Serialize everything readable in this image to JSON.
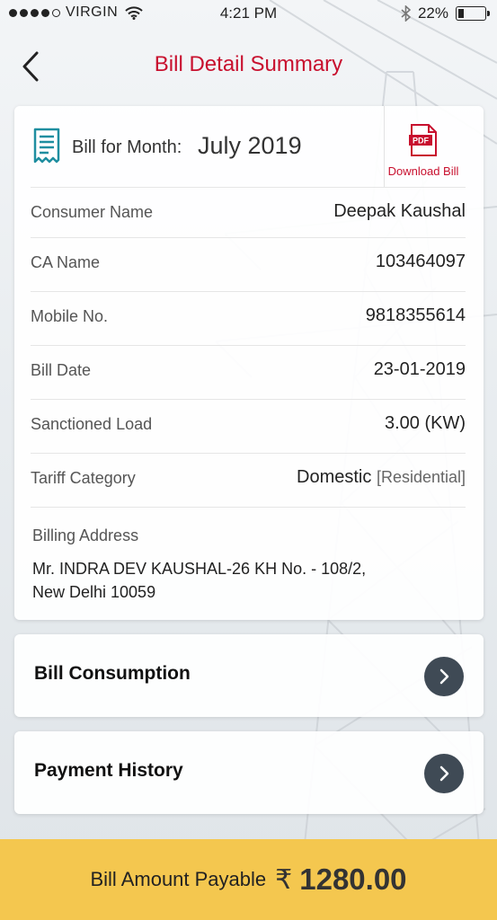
{
  "status_bar": {
    "carrier": "VIRGIN",
    "time": "4:21 PM",
    "battery": "22%",
    "battery_level": 0.22
  },
  "nav": {
    "title": "Bill Detail Summary"
  },
  "bill_header": {
    "label": "Bill for Month:",
    "month": "July 2019",
    "pdf_badge": "PDF",
    "download_label": "Download Bill"
  },
  "details": [
    {
      "label": "Consumer Name",
      "value": "Deepak Kaushal"
    },
    {
      "label": "CA Name",
      "value": "103464097"
    },
    {
      "label": "Mobile No.",
      "value": "9818355614"
    },
    {
      "label": "Bill Date",
      "value": "23-01-2019"
    },
    {
      "label": "Sanctioned Load",
      "value": "3.00 (KW)"
    },
    {
      "label": "Tariff Category",
      "value": "Domestic",
      "value_sub": "[Residential]"
    }
  ],
  "address": {
    "label": "Billing Address",
    "line1": "Mr. INDRA DEV KAUSHAL-26 KH No. - 108/2,",
    "line2": "New Delhi 10059"
  },
  "links": [
    {
      "label": "Bill Consumption"
    },
    {
      "label": "Payment History"
    }
  ],
  "footer": {
    "label": "Bill Amount Payable",
    "currency_symbol": "₹",
    "amount": "1280.00"
  },
  "colors": {
    "accent_red": "#c8102e",
    "footer_yellow": "#f4c74f",
    "icon_teal": "#1f8ea0",
    "chevron_bg": "#3f4a55"
  }
}
